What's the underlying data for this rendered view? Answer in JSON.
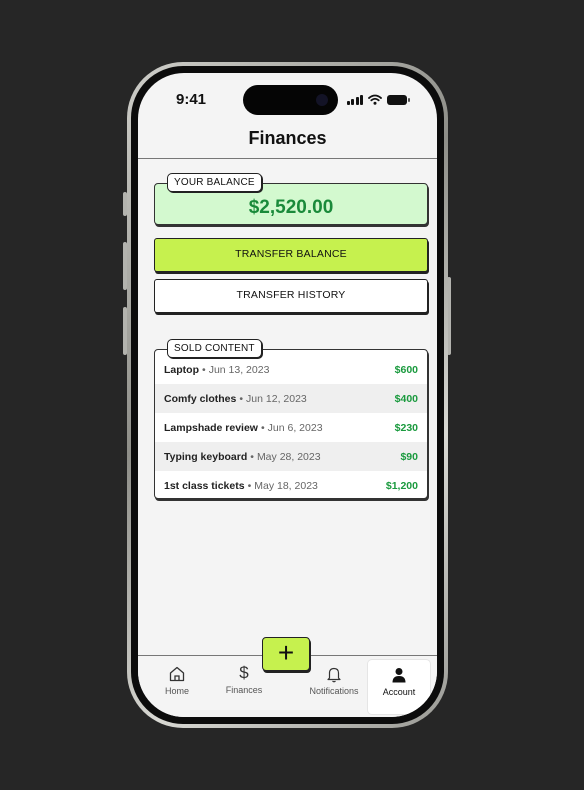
{
  "status_bar": {
    "time": "9:41"
  },
  "header": {
    "title": "Finances"
  },
  "balance": {
    "tag": "YOUR BALANCE",
    "amount": "$2,520.00"
  },
  "actions": {
    "transfer_label": "TRANSFER BALANCE",
    "history_label": "TRANSFER HISTORY"
  },
  "sold": {
    "tag": "SOLD CONTENT",
    "items": [
      {
        "name": "Laptop",
        "date": "Jun 13, 2023",
        "price": "$600"
      },
      {
        "name": "Comfy clothes",
        "date": "Jun 12, 2023",
        "price": "$400"
      },
      {
        "name": "Lampshade review",
        "date": "Jun 6, 2023",
        "price": "$230"
      },
      {
        "name": "Typing keyboard",
        "date": "May 28, 2023",
        "price": "$90"
      },
      {
        "name": "1st class tickets",
        "date": "May 18, 2023",
        "price": "$1,200"
      }
    ]
  },
  "tabbar": {
    "home": "Home",
    "finances": "Finances",
    "finances_symbol": "$",
    "notifications": "Notifications",
    "account": "Account",
    "add_symbol": "+"
  },
  "colors": {
    "accent": "#c6f14e",
    "balance_bg": "#d3f9cf",
    "money_green": "#1a9a3e",
    "background": "#262626"
  },
  "icons": [
    "home-icon",
    "dollar-icon",
    "bell-icon",
    "user-icon",
    "plus-icon",
    "signal-icon",
    "wifi-icon",
    "battery-icon"
  ]
}
